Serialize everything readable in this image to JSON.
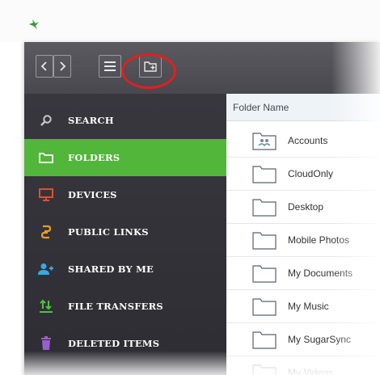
{
  "toolbar": {
    "back_icon": "chevron-left-icon",
    "forward_icon": "chevron-right-icon",
    "menu_icon": "hamburger-menu-icon",
    "new_folder_icon": "new-folder-icon",
    "highlight_color": "#e02020"
  },
  "sidebar": {
    "items": [
      {
        "label": "SEARCH",
        "icon": "search-icon",
        "icon_color": "#c8c8cc"
      },
      {
        "label": "FOLDERS",
        "icon": "folder-icon",
        "icon_color": "#ffffff",
        "active": true
      },
      {
        "label": "DEVICES",
        "icon": "monitor-icon",
        "icon_color": "#e0502a"
      },
      {
        "label": "PUBLIC LINKS",
        "icon": "link-icon",
        "icon_color": "#e8a020"
      },
      {
        "label": "SHARED BY ME",
        "icon": "shared-user-icon",
        "icon_color": "#3aa8e8"
      },
      {
        "label": "FILE TRANSFERS",
        "icon": "transfer-icon",
        "icon_color": "#52c040"
      },
      {
        "label": "DELETED ITEMS",
        "icon": "trash-icon",
        "icon_color": "#9a60c8"
      }
    ],
    "active_color": "#52b63a"
  },
  "list": {
    "header": "Folder Name",
    "rows": [
      {
        "name": "Accounts",
        "icon": "shared-folder-icon"
      },
      {
        "name": "CloudOnly",
        "icon": "folder-icon"
      },
      {
        "name": "Desktop",
        "icon": "folder-icon"
      },
      {
        "name": "Mobile Photos",
        "icon": "folder-icon"
      },
      {
        "name": "My Documents",
        "icon": "folder-icon"
      },
      {
        "name": "My Music",
        "icon": "folder-icon"
      },
      {
        "name": "My SugarSync",
        "icon": "folder-icon"
      },
      {
        "name": "My Videos",
        "icon": "folder-icon"
      }
    ]
  }
}
